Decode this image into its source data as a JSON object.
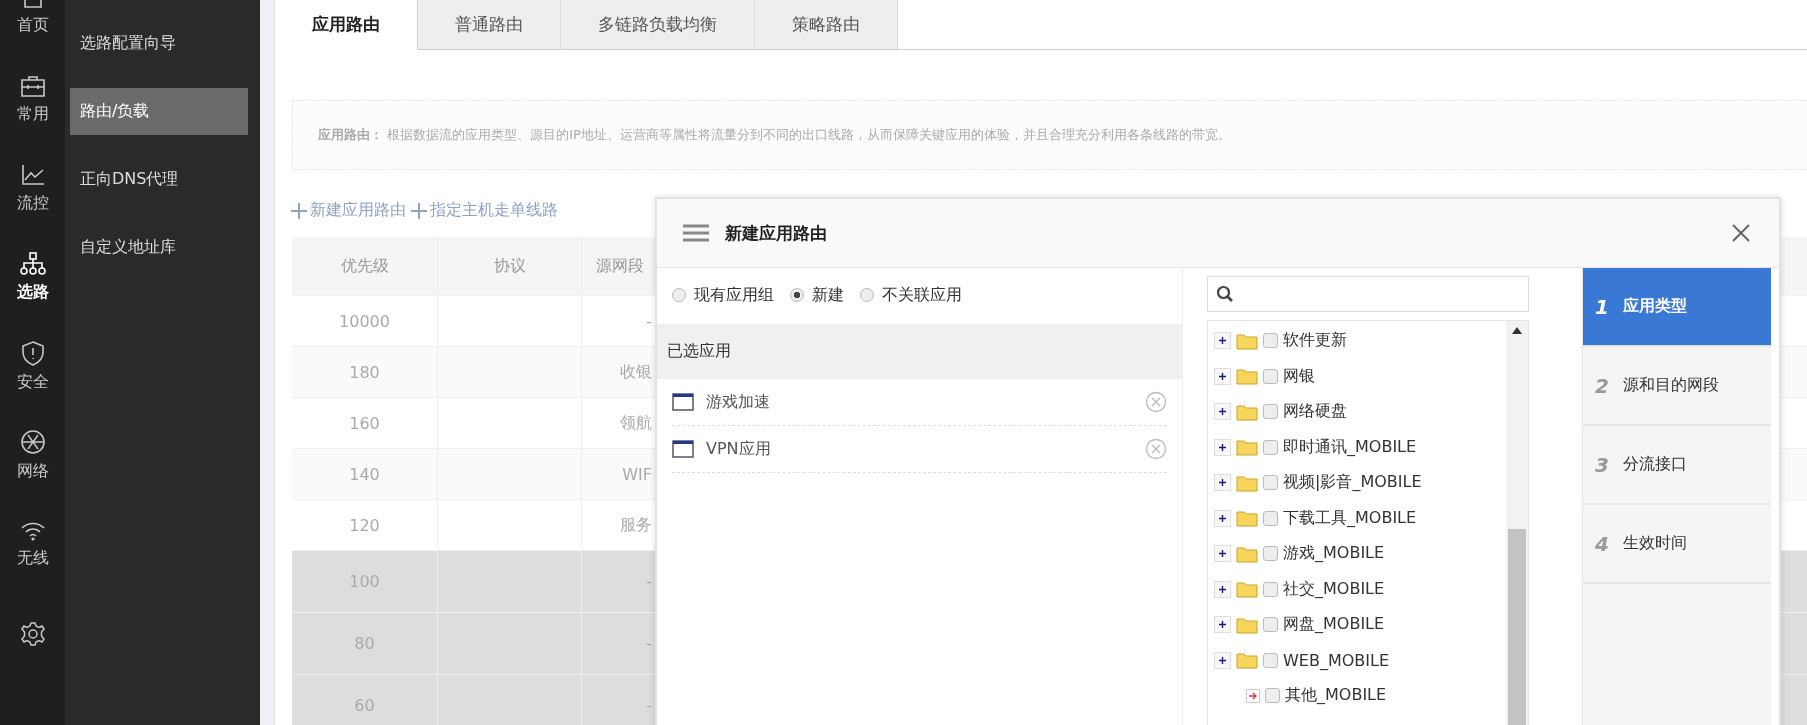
{
  "nav_rail": [
    {
      "kind": "home",
      "label": "首页",
      "selected": false
    },
    {
      "kind": "briefcase",
      "label": "常用",
      "selected": false
    },
    {
      "kind": "chart",
      "label": "流控",
      "selected": false
    },
    {
      "kind": "network",
      "label": "选路",
      "selected": true
    },
    {
      "kind": "shield",
      "label": "安全",
      "selected": false
    },
    {
      "kind": "globe",
      "label": "网络",
      "selected": false
    },
    {
      "kind": "wifi",
      "label": "无线",
      "selected": false
    },
    {
      "kind": "gear",
      "selected": false
    }
  ],
  "submenu": [
    {
      "label": "选路配置向导",
      "selected": false
    },
    {
      "label": "路由/负载",
      "selected": true
    },
    {
      "label": "正向DNS代理",
      "selected": false
    },
    {
      "label": "自定义地址库",
      "selected": false
    }
  ],
  "tabs": [
    {
      "label": "应用路由",
      "selected": true
    },
    {
      "label": "普通路由",
      "selected": false
    },
    {
      "label": "多链路负载均衡",
      "selected": false
    },
    {
      "label": "策略路由",
      "selected": false
    }
  ],
  "description": "**应用路由：** 根据数据流的应用类型、源目的IP地址、运营商等属性将流量分到不同的出口线路，从而保障关键应用的体验，并且合理充分利用各条线路的带宽。",
  "actions": [
    "新建应用路由",
    "指定主机走单线路"
  ],
  "table": {
    "columns": [
      "优先级",
      "协议",
      "源网段"
    ],
    "rows": [
      {
        "priority": "10000",
        "source": "-",
        "disabled": false
      },
      {
        "priority": "180",
        "source": "收银",
        "disabled": false
      },
      {
        "priority": "160",
        "source": "领航",
        "disabled": false
      },
      {
        "priority": "140",
        "source": "WIF",
        "disabled": false
      },
      {
        "priority": "120",
        "source": "服务",
        "disabled": false
      },
      {
        "priority": "100",
        "source": "-",
        "disabled": true
      },
      {
        "priority": "80",
        "source": "-",
        "disabled": true
      },
      {
        "priority": "60",
        "source": "-",
        "disabled": true
      }
    ]
  },
  "dialog": {
    "title": "新建应用路由",
    "scope_options": [
      {
        "label": "现有应用组",
        "selected": false
      },
      {
        "label": "新建",
        "selected": true
      },
      {
        "label": "不关联应用",
        "selected": false
      }
    ],
    "selected_header": "已选应用",
    "selected_apps": [
      "游戏加速",
      "VPN应用"
    ],
    "tree": [
      {
        "kind": "folder",
        "label": "软件更新",
        "expanded": false,
        "checked": false
      },
      {
        "kind": "folder",
        "label": "网银",
        "expanded": false,
        "checked": false
      },
      {
        "kind": "folder",
        "label": "网络硬盘",
        "expanded": false,
        "checked": false
      },
      {
        "kind": "folder",
        "label": "即时通讯_MOBILE",
        "expanded": false,
        "checked": false
      },
      {
        "kind": "folder",
        "label": "视频|影音_MOBILE",
        "expanded": false,
        "checked": false
      },
      {
        "kind": "folder",
        "label": "下载工具_MOBILE",
        "expanded": false,
        "checked": false
      },
      {
        "kind": "folder",
        "label": "游戏_MOBILE",
        "expanded": false,
        "checked": false
      },
      {
        "kind": "folder",
        "label": "社交_MOBILE",
        "expanded": false,
        "checked": false
      },
      {
        "kind": "folder",
        "label": "网盘_MOBILE",
        "expanded": false,
        "checked": false
      },
      {
        "kind": "folder",
        "label": "WEB_MOBILE",
        "expanded": false,
        "checked": false
      },
      {
        "kind": "leaf",
        "label": "其他_MOBILE",
        "checked": false
      }
    ],
    "steps": [
      {
        "number": "1",
        "label": "应用类型",
        "selected": true
      },
      {
        "number": "2",
        "label": "源和目的网段",
        "selected": false
      },
      {
        "number": "3",
        "label": "分流接口",
        "selected": false
      },
      {
        "number": "4",
        "label": "生效时间",
        "selected": false
      }
    ]
  }
}
